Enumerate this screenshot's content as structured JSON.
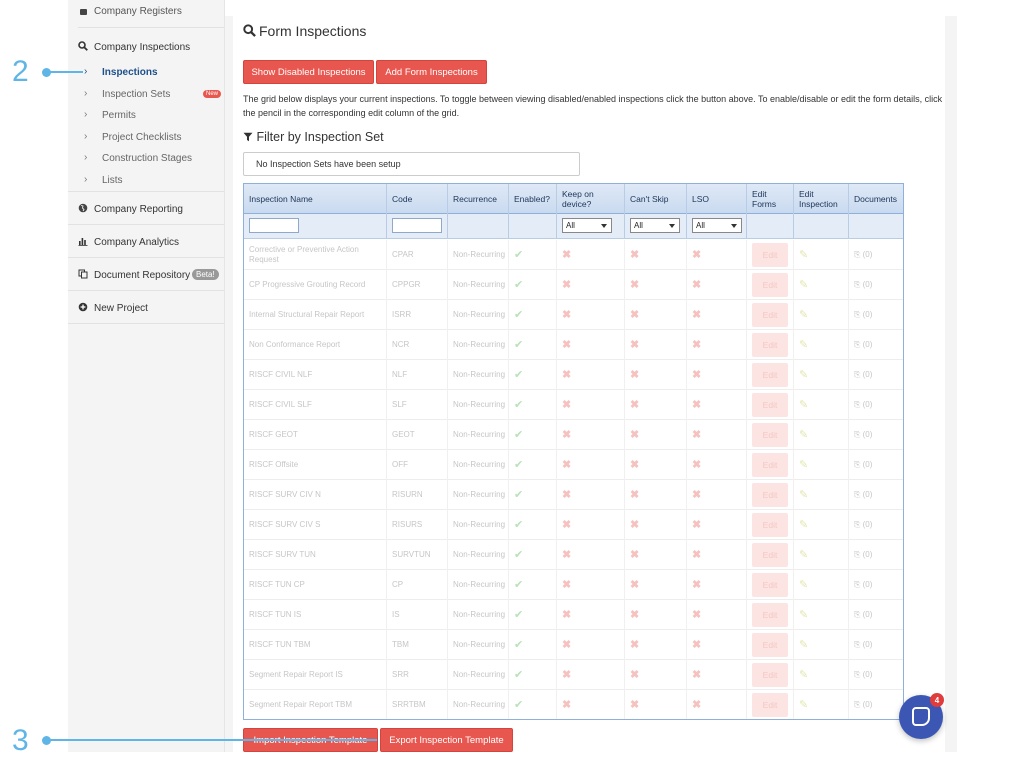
{
  "sidebar": {
    "top_item": "Company Registers",
    "company_inspections": "Company Inspections",
    "sub_items": [
      {
        "label": "Inspections",
        "active": true
      },
      {
        "label": "Inspection Sets",
        "badge": "New"
      },
      {
        "label": "Permits"
      },
      {
        "label": "Project Checklists"
      },
      {
        "label": "Construction Stages"
      },
      {
        "label": "Lists"
      }
    ],
    "company_reporting": "Company Reporting",
    "company_analytics": "Company Analytics",
    "document_repository": "Document Repository",
    "beta_badge": "Beta!",
    "new_project": "New Project"
  },
  "main": {
    "title": "Form Inspections",
    "show_disabled_label": "Show Disabled Inspections",
    "add_form_label": "Add Form Inspections",
    "description": "The grid below displays your current inspections. To toggle between viewing disabled/enabled inspections click the button above. To enable/disable or edit the form details, click the pencil in the corresponding edit column of the grid.",
    "filter_title": "Filter by Inspection Set",
    "filter_placeholder": "No Inspection Sets have been setup",
    "import_label": "Import Inspection Template",
    "export_label": "Export Inspection Template"
  },
  "grid": {
    "headers": [
      "Inspection Name",
      "Code",
      "Recurrence",
      "Enabled?",
      "Keep on device?",
      "Can't Skip",
      "LSO",
      "Edit Forms",
      "Edit Inspection",
      "Documents"
    ],
    "filter_option": "All",
    "edit_label": "Edit",
    "docs_label": "(0)",
    "rows": [
      {
        "name": "Corrective or Preventive Action Request",
        "code": "CPAR",
        "recurrence": "Non-Recurring"
      },
      {
        "name": "CP Progressive Grouting Record",
        "code": "CPPGR",
        "recurrence": "Non-Recurring"
      },
      {
        "name": "Internal Structural Repair Report",
        "code": "ISRR",
        "recurrence": "Non-Recurring"
      },
      {
        "name": "Non Conformance Report",
        "code": "NCR",
        "recurrence": "Non-Recurring"
      },
      {
        "name": "RISCF CIVIL NLF",
        "code": "NLF",
        "recurrence": "Non-Recurring"
      },
      {
        "name": "RISCF CIVIL SLF",
        "code": "SLF",
        "recurrence": "Non-Recurring"
      },
      {
        "name": "RISCF GEOT",
        "code": "GEOT",
        "recurrence": "Non-Recurring"
      },
      {
        "name": "RISCF Offsite",
        "code": "OFF",
        "recurrence": "Non-Recurring"
      },
      {
        "name": "RISCF SURV CIV N",
        "code": "RISURN",
        "recurrence": "Non-Recurring"
      },
      {
        "name": "RISCF SURV CIV S",
        "code": "RISURS",
        "recurrence": "Non-Recurring"
      },
      {
        "name": "RISCF SURV TUN",
        "code": "SURVTUN",
        "recurrence": "Non-Recurring"
      },
      {
        "name": "RISCF TUN CP",
        "code": "CP",
        "recurrence": "Non-Recurring"
      },
      {
        "name": "RISCF TUN IS",
        "code": "IS",
        "recurrence": "Non-Recurring"
      },
      {
        "name": "RISCF TUN TBM",
        "code": "TBM",
        "recurrence": "Non-Recurring"
      },
      {
        "name": "Segment Repair Report IS",
        "code": "SRR",
        "recurrence": "Non-Recurring"
      },
      {
        "name": "Segment Repair Report TBM",
        "code": "SRRTBM",
        "recurrence": "Non-Recurring"
      }
    ]
  },
  "annotations": {
    "step_2": "2",
    "step_3": "3"
  },
  "chat": {
    "badge_count": "4"
  },
  "colors": {
    "accent": "#e8574f",
    "annotation": "#5fb5e5",
    "active_link": "#1d4f8a",
    "chat": "#3b57b3"
  }
}
